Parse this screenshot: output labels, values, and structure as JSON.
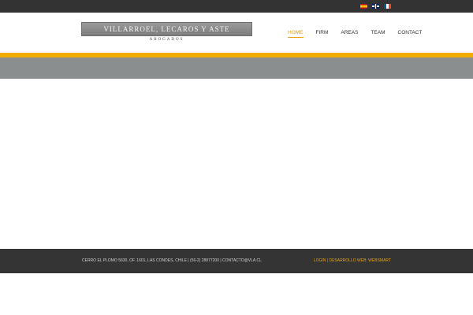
{
  "topbar": {
    "flags": [
      {
        "name": "flag-spanish",
        "icon": "flag-es-icon"
      },
      {
        "name": "flag-english",
        "icon": "flag-uk-icon"
      },
      {
        "name": "flag-french",
        "icon": "flag-fr-icon"
      }
    ]
  },
  "logo": {
    "name": "VILLARROEL, LECAROS Y ASTE",
    "subtitle": "ABOGADOS"
  },
  "nav": {
    "items": [
      {
        "label": "HOME",
        "active": true
      },
      {
        "label": "FIRM",
        "active": false
      },
      {
        "label": "AREAS",
        "active": false
      },
      {
        "label": "TEAM",
        "active": false
      },
      {
        "label": "CONTACT",
        "active": false
      }
    ]
  },
  "footer": {
    "address": "CERRO EL PLOMO 5630, OF. 1601, LAS CONDES, CHILE | (56-2) 28877200 | CONTACTO@VLA.CL",
    "login": "LOGIN",
    "separator": "|",
    "credit": "DESARROLLO WEB: WEBSMART"
  },
  "colors": {
    "accent": "#f0ad00",
    "topbar": "#333333",
    "band": "#8b8e8e",
    "footer": "#343434"
  }
}
